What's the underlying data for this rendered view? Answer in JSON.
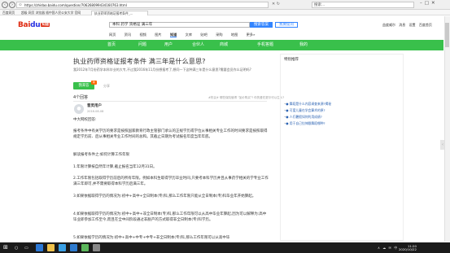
{
  "browser": {
    "url": "https://zhidao.baidu.com/question/706268099434160763.html",
    "search_placeholder": "搜索...",
    "tabs": [
      "百度网页",
      "超级 网页 浏览器 插件 下载",
      "中国人民公安大学 官网"
    ],
    "active_tab": "执业药师资格证报考条件_..."
  },
  "header": {
    "logo_text": "Bai",
    "logo_paw": "du",
    "logo_zh": "知道",
    "query": "本科 药学 资格证 满三年",
    "search_button": "搜索答案",
    "ask_button": "我要提问",
    "user_links": "益度威尔 消息 设置 百度首页",
    "nav": [
      "网页",
      "资讯",
      "视频",
      "图片",
      "知道",
      "文库",
      "贴吧",
      "采购",
      "地图",
      "更多»"
    ],
    "active_nav": "知道"
  },
  "green_nav": [
    "首页",
    "问题",
    "用户",
    "合伙人",
    "商城",
    "手机答题",
    "我的"
  ],
  "question": {
    "title": "执业药师资格证报考条件 满三年是什么意思?",
    "description": "我2012年7月份药学本科毕业的大专,不过我2016年11月份想报考了,想问一下这种满三年是什么意思?需要会员作么证明吗?",
    "answer_button": "我来答",
    "new_badge": "新",
    "share": "分享",
    "answers_count": "4个回答",
    "related": "#热议# 哪些保险值得 \"加价购买\"?   你的爱在夏尔可以生么?",
    "author": "普灵用户",
    "author_date": "2016-08-08"
  },
  "answer_paragraphs": [
    "中大网校回答:",
    "报考条件中有关学历的要求是按照国家教育行政主管部门承认的正规学历或学位从事相关专业工作的时间要求是按照取得规定学历前、后从事相关专业工作时间的总和。其截止日期为考试报名年度当年年底。",
    "解读报考条件之:如何计算工作年限",
    "1.年限计算按自然年计算,截止报名当年12月31日。",
    "2.工作年限包括取得学历前后的所有年限。例如本科生取得学历毕业时间,只要考本科学历并且从事药学相关的学专业工作满三年即可,并不需要取得本科学历后满三年。",
    "3.如果依据取得学历的情况为:初中+高中+全日制本(专)科,那么工作年限只能从全日制本(专)科毕业年开始算起。",
    "4.如果依据取得学历的情况为:初中+高中+非全日制本(专)科,那么工作年限可以从高中毕业年算起,因为可以解释为:高中毕业即参加工作至今,而且在全中间阶段通过非脱产的方式取得非全日制本(专)科学历。",
    "5.如果依据学历的情况为:初中+高中+中专+中专+非全日制本(专)科,那么工作年限可以从高中毕"
  ],
  "sidebar": {
    "title": "特别推荐",
    "links": [
      "● 舞蹈是什么内容调查来源?揭秘",
      "● 可爱儿童在学会算术的原?",
      "● 人们暑假如何利用成绩?",
      "● 用于自己拉伸跟舞蹈哪种?"
    ]
  },
  "taskbar": {
    "time": "11:20",
    "date": "2020/10/22",
    "tray": "∧ ☁ ✉ 中"
  }
}
